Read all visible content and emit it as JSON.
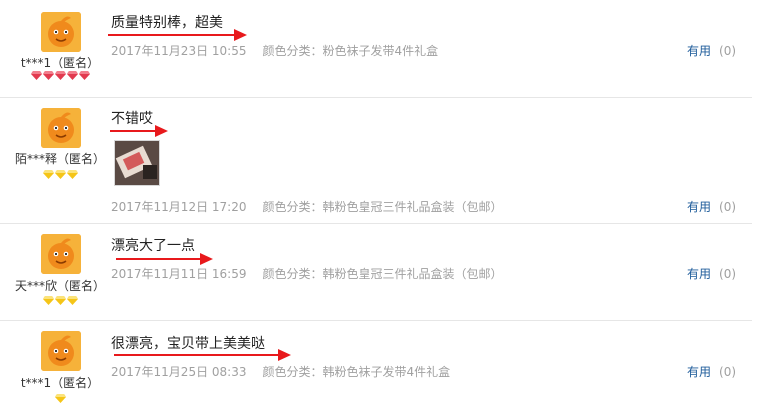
{
  "reviews": [
    {
      "user": "t***1（匿名）",
      "level": "diamond",
      "badge_count": 5,
      "content": "质量特别棒，超美",
      "date": "2017年11月23日 10:55",
      "sku": "颜色分类：粉色袜子发带4件礼盒",
      "useful_label": "有用",
      "useful_count": "(0)"
    },
    {
      "user": "陌***释（匿名）",
      "level": "gold",
      "badge_count": 3,
      "content": "不错哎",
      "has_photo": true,
      "date": "2017年11月12日 17:20",
      "sku": "颜色分类：韩粉色皇冠三件礼品盒装（包邮）",
      "useful_label": "有用",
      "useful_count": "(0)"
    },
    {
      "user": "天***欣（匿名）",
      "level": "gold",
      "badge_count": 3,
      "content": "漂亮大了一点",
      "date": "2017年11月11日 16:59",
      "sku": "颜色分类：韩粉色皇冠三件礼品盒装（包邮）",
      "useful_label": "有用",
      "useful_count": "(0)"
    },
    {
      "user": "t***1（匿名）",
      "level": "gold",
      "badge_count": 1,
      "content": "很漂亮，宝贝带上美美哒",
      "date": "2017年11月25日 08:33",
      "sku": "颜色分类：韩粉色袜子发带4件礼盒",
      "useful_label": "有用",
      "useful_count": "(0)"
    }
  ],
  "colors": {
    "arrow": "#e8191c",
    "link": "#1d5b9a",
    "meta": "#a0a0a0",
    "avatar": "#f6b23a",
    "diamond": "#e23a4f",
    "gold": "#f5c518"
  }
}
